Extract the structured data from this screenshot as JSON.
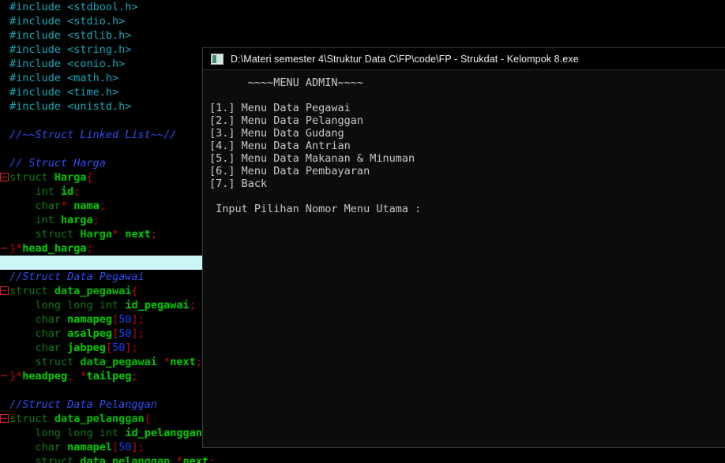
{
  "editor": {
    "name": "code-editor",
    "background": "#000000",
    "current_line_highlight": "#ccf5f7",
    "colors": {
      "preprocessor": "#18a6b8",
      "comment": "#2e4ef0",
      "keyword": "#0f7a15",
      "identifier": "#00c000",
      "punctuation": "#d40000",
      "number": "#1a40ff"
    },
    "lines": [
      {
        "id": "l1",
        "fold": "none",
        "current": false,
        "tokens": [
          {
            "t": "#include <stdbool.h>",
            "c": "pre"
          }
        ]
      },
      {
        "id": "l2",
        "fold": "none",
        "current": false,
        "tokens": [
          {
            "t": "#include <stdio.h>",
            "c": "pre"
          }
        ]
      },
      {
        "id": "l3",
        "fold": "none",
        "current": false,
        "tokens": [
          {
            "t": "#include <stdlib.h>",
            "c": "pre"
          }
        ]
      },
      {
        "id": "l4",
        "fold": "none",
        "current": false,
        "tokens": [
          {
            "t": "#include <string.h>",
            "c": "pre"
          }
        ]
      },
      {
        "id": "l5",
        "fold": "none",
        "current": false,
        "tokens": [
          {
            "t": "#include <conio.h>",
            "c": "pre"
          }
        ]
      },
      {
        "id": "l6",
        "fold": "none",
        "current": false,
        "tokens": [
          {
            "t": "#include <math.h>",
            "c": "pre"
          }
        ]
      },
      {
        "id": "l7",
        "fold": "none",
        "current": false,
        "tokens": [
          {
            "t": "#include <time.h>",
            "c": "pre"
          }
        ]
      },
      {
        "id": "l8",
        "fold": "none",
        "current": false,
        "tokens": [
          {
            "t": "#include <unistd.h>",
            "c": "pre"
          }
        ]
      },
      {
        "id": "l9",
        "fold": "none",
        "current": false,
        "tokens": []
      },
      {
        "id": "l10",
        "fold": "none",
        "current": false,
        "tokens": [
          {
            "t": "//~~Struct Linked List~~//",
            "c": "cmt"
          }
        ]
      },
      {
        "id": "l11",
        "fold": "none",
        "current": false,
        "tokens": []
      },
      {
        "id": "l12",
        "fold": "none",
        "current": false,
        "tokens": [
          {
            "t": "// Struct Harga",
            "c": "cmt"
          }
        ]
      },
      {
        "id": "l13",
        "fold": "start",
        "current": false,
        "tokens": [
          {
            "t": "struct ",
            "c": "kw"
          },
          {
            "t": "Harga",
            "c": "type"
          },
          {
            "t": "{",
            "c": "punc"
          }
        ]
      },
      {
        "id": "l14",
        "fold": "none",
        "current": false,
        "tokens": [
          {
            "t": "    int ",
            "c": "kw"
          },
          {
            "t": "id",
            "c": "id"
          },
          {
            "t": ";",
            "c": "punc"
          }
        ]
      },
      {
        "id": "l15",
        "fold": "none",
        "current": false,
        "tokens": [
          {
            "t": "    char",
            "c": "kw"
          },
          {
            "t": "* ",
            "c": "punc"
          },
          {
            "t": "nama",
            "c": "id"
          },
          {
            "t": ";",
            "c": "punc"
          }
        ]
      },
      {
        "id": "l16",
        "fold": "none",
        "current": false,
        "tokens": [
          {
            "t": "    int ",
            "c": "kw"
          },
          {
            "t": "harga",
            "c": "id"
          },
          {
            "t": ";",
            "c": "punc"
          }
        ]
      },
      {
        "id": "l17",
        "fold": "none",
        "current": false,
        "tokens": [
          {
            "t": "    struct ",
            "c": "kw"
          },
          {
            "t": "Harga",
            "c": "type"
          },
          {
            "t": "* ",
            "c": "punc"
          },
          {
            "t": "next",
            "c": "id"
          },
          {
            "t": ";",
            "c": "punc"
          }
        ]
      },
      {
        "id": "l18",
        "fold": "end",
        "current": false,
        "tokens": [
          {
            "t": "}*",
            "c": "punc"
          },
          {
            "t": "head_harga",
            "c": "id"
          },
          {
            "t": ";",
            "c": "punc"
          }
        ]
      },
      {
        "id": "l19",
        "fold": "none",
        "current": true,
        "tokens": []
      },
      {
        "id": "l20",
        "fold": "none",
        "current": false,
        "tokens": [
          {
            "t": "//Struct Data Pegawai",
            "c": "cmt"
          }
        ]
      },
      {
        "id": "l21",
        "fold": "start",
        "current": false,
        "tokens": [
          {
            "t": "struct ",
            "c": "kw"
          },
          {
            "t": "data_pegawai",
            "c": "type"
          },
          {
            "t": "{",
            "c": "punc"
          }
        ]
      },
      {
        "id": "l22",
        "fold": "none",
        "current": false,
        "tokens": [
          {
            "t": "    long long int ",
            "c": "kw"
          },
          {
            "t": "id_pegawai",
            "c": "id"
          },
          {
            "t": ";",
            "c": "punc"
          }
        ]
      },
      {
        "id": "l23",
        "fold": "none",
        "current": false,
        "tokens": [
          {
            "t": "    char ",
            "c": "kw"
          },
          {
            "t": "namapeg",
            "c": "id"
          },
          {
            "t": "[",
            "c": "punc"
          },
          {
            "t": "50",
            "c": "num"
          },
          {
            "t": "];",
            "c": "punc"
          }
        ]
      },
      {
        "id": "l24",
        "fold": "none",
        "current": false,
        "tokens": [
          {
            "t": "    char ",
            "c": "kw"
          },
          {
            "t": "asalpeg",
            "c": "id"
          },
          {
            "t": "[",
            "c": "punc"
          },
          {
            "t": "50",
            "c": "num"
          },
          {
            "t": "];",
            "c": "punc"
          }
        ]
      },
      {
        "id": "l25",
        "fold": "none",
        "current": false,
        "tokens": [
          {
            "t": "    char ",
            "c": "kw"
          },
          {
            "t": "jabpeg",
            "c": "id"
          },
          {
            "t": "[",
            "c": "punc"
          },
          {
            "t": "50",
            "c": "num"
          },
          {
            "t": "];",
            "c": "punc"
          }
        ]
      },
      {
        "id": "l26",
        "fold": "none",
        "current": false,
        "tokens": [
          {
            "t": "    struct ",
            "c": "kw"
          },
          {
            "t": "data_pegawai ",
            "c": "type"
          },
          {
            "t": "*",
            "c": "punc"
          },
          {
            "t": "next",
            "c": "id"
          },
          {
            "t": ";",
            "c": "punc"
          }
        ]
      },
      {
        "id": "l27",
        "fold": "end",
        "current": false,
        "tokens": [
          {
            "t": "}*",
            "c": "punc"
          },
          {
            "t": "headpeg",
            "c": "id"
          },
          {
            "t": ", *",
            "c": "punc"
          },
          {
            "t": "tailpeg",
            "c": "id"
          },
          {
            "t": ";",
            "c": "punc"
          }
        ]
      },
      {
        "id": "l28",
        "fold": "none",
        "current": false,
        "tokens": []
      },
      {
        "id": "l29",
        "fold": "none",
        "current": false,
        "tokens": [
          {
            "t": "//Struct Data Pelanggan",
            "c": "cmt"
          }
        ]
      },
      {
        "id": "l30",
        "fold": "start",
        "current": false,
        "tokens": [
          {
            "t": "struct ",
            "c": "kw"
          },
          {
            "t": "data_pelanggan",
            "c": "type"
          },
          {
            "t": "{",
            "c": "punc"
          }
        ]
      },
      {
        "id": "l31",
        "fold": "none",
        "current": false,
        "tokens": [
          {
            "t": "    long long int ",
            "c": "kw"
          },
          {
            "t": "id_pelanggan",
            "c": "id"
          },
          {
            "t": ";",
            "c": "punc"
          }
        ]
      },
      {
        "id": "l32",
        "fold": "none",
        "current": false,
        "tokens": [
          {
            "t": "    char ",
            "c": "kw"
          },
          {
            "t": "namapel",
            "c": "id"
          },
          {
            "t": "[",
            "c": "punc"
          },
          {
            "t": "50",
            "c": "num"
          },
          {
            "t": "];",
            "c": "punc"
          }
        ]
      },
      {
        "id": "l33",
        "fold": "none",
        "current": false,
        "tokens": [
          {
            "t": "    struct ",
            "c": "kw"
          },
          {
            "t": "data_pelanggan ",
            "c": "type"
          },
          {
            "t": "*",
            "c": "punc"
          },
          {
            "t": "next",
            "c": "id"
          },
          {
            "t": ";",
            "c": "punc"
          }
        ]
      }
    ]
  },
  "console": {
    "title": "D:\\Materi semester 4\\Struktur Data C\\FP\\code\\FP - Strukdat - Kelompok 8.exe",
    "icon": "console-window-icon",
    "background": "#0c0c0c",
    "text_color": "#c8c8c8",
    "lines": [
      "      ~~~~MENU ADMIN~~~~",
      "",
      "[1.] Menu Data Pegawai",
      "[2.] Menu Data Pelanggan",
      "[3.] Menu Data Gudang",
      "[4.] Menu Data Antrian",
      "[5.] Menu Data Makanan & Minuman",
      "[6.] Menu Data Pembayaran",
      "[7.] Back",
      "",
      " Input Pilihan Nomor Menu Utama :"
    ]
  }
}
